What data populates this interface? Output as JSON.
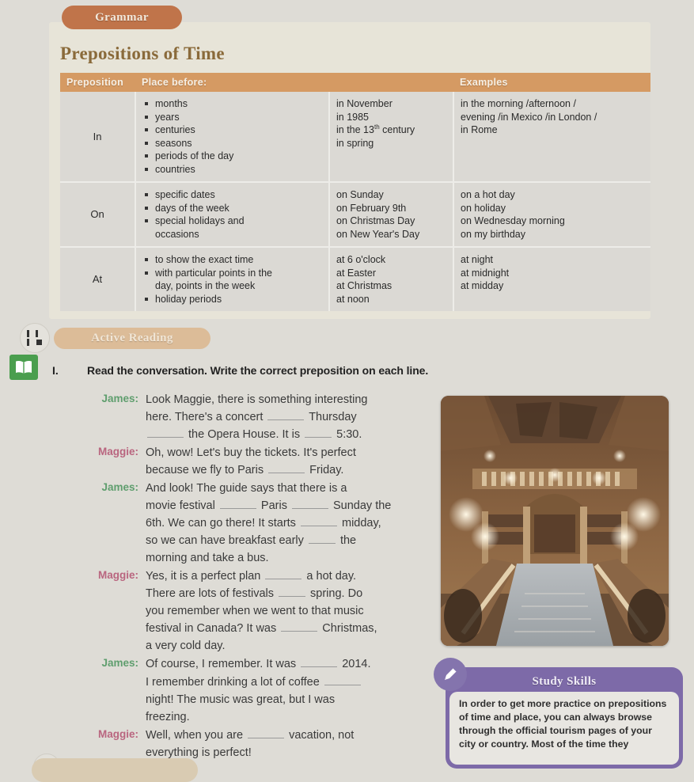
{
  "grammar": {
    "badge_label": "Grammar",
    "title": "Prepositions of Time",
    "table": {
      "headers": [
        "Preposition",
        "Place before:",
        "",
        "Examples"
      ],
      "rows": [
        {
          "preposition": "In",
          "rules": [
            "months",
            "years",
            "centuries",
            "seasons",
            "periods of the day",
            "countries"
          ],
          "examples_1": [
            "in November",
            "in 1985",
            "in the 13th century",
            "in spring"
          ],
          "examples_1_sup_index": 2,
          "examples_2": [
            "in the morning /afternoon /",
            "evening /in Mexico /in London /",
            "in Rome"
          ]
        },
        {
          "preposition": "On",
          "rules": [
            "specific dates",
            "days of the week",
            "special holidays and",
            "occasions"
          ],
          "continuation_index": 3,
          "examples_1": [
            "on Sunday",
            "on February 9th",
            "on Christmas Day",
            "on New Year's Day"
          ],
          "examples_2": [
            "on a hot day",
            "on holiday",
            "on Wednesday morning",
            "on my birthday"
          ]
        },
        {
          "preposition": "At",
          "rules": [
            "to show the exact time",
            "with particular points in the",
            "day, points in the week",
            "holiday periods"
          ],
          "continuation_index": 2,
          "examples_1": [
            "at 6 o'clock",
            "at Easter",
            "at Christmas",
            "at noon"
          ],
          "examples_2": [
            "at night",
            "at midnight",
            "at midday"
          ]
        }
      ]
    }
  },
  "active_reading": {
    "badge_label": "Active Reading",
    "qr_icon": "qr-code-icon",
    "book_icon": "open-book-icon"
  },
  "task": {
    "number": "I.",
    "instruction": "Read the conversation. Write the correct preposition on each line."
  },
  "conversation": [
    {
      "speaker": "James:",
      "speaker_color": "#5f9e6e",
      "lines": [
        [
          {
            "t": "Look Maggie, there is something interesting"
          }
        ],
        [
          {
            "t": "here. There's a concert "
          },
          {
            "blank": true
          },
          {
            "t": " Thursday"
          }
        ],
        [
          {
            "blank": true
          },
          {
            "t": " the Opera House. It is "
          },
          {
            "blank": true,
            "short": true
          },
          {
            "t": " 5:30."
          }
        ]
      ]
    },
    {
      "speaker": "Maggie:",
      "speaker_color": "#b9657f",
      "lines": [
        [
          {
            "t": "Oh, wow! Let's buy the tickets. It's perfect"
          }
        ],
        [
          {
            "t": "because we fly to Paris "
          },
          {
            "blank": true
          },
          {
            "t": " Friday."
          }
        ]
      ]
    },
    {
      "speaker": "James:",
      "speaker_color": "#5f9e6e",
      "lines": [
        [
          {
            "t": "And look! The guide says that there is a"
          }
        ],
        [
          {
            "t": "movie festival "
          },
          {
            "blank": true
          },
          {
            "t": " Paris "
          },
          {
            "blank": true
          },
          {
            "t": " Sunday the"
          }
        ],
        [
          {
            "t": "6th. We can go there! It starts "
          },
          {
            "blank": true
          },
          {
            "t": " midday,"
          }
        ],
        [
          {
            "t": "so we can have breakfast early "
          },
          {
            "blank": true,
            "short": true
          },
          {
            "t": " the"
          }
        ],
        [
          {
            "t": "morning and take a bus."
          }
        ]
      ]
    },
    {
      "speaker": "Maggie:",
      "speaker_color": "#b9657f",
      "lines": [
        [
          {
            "t": "Yes, it is a perfect plan "
          },
          {
            "blank": true
          },
          {
            "t": " a hot day."
          }
        ],
        [
          {
            "t": "There are lots of festivals "
          },
          {
            "blank": true,
            "short": true
          },
          {
            "t": " spring. Do"
          }
        ],
        [
          {
            "t": "you remember when we went to that music"
          }
        ],
        [
          {
            "t": "festival in Canada? It was "
          },
          {
            "blank": true
          },
          {
            "t": " Christmas,"
          }
        ],
        [
          {
            "t": "a very cold day."
          }
        ]
      ]
    },
    {
      "speaker": "James:",
      "speaker_color": "#5f9e6e",
      "lines": [
        [
          {
            "t": "Of course, I remember. It was "
          },
          {
            "blank": true
          },
          {
            "t": " 2014."
          }
        ],
        [
          {
            "t": "I remember drinking a lot of coffee "
          },
          {
            "blank": true
          }
        ],
        [
          {
            "t": "night! The music was great, but I was"
          }
        ],
        [
          {
            "t": "freezing."
          }
        ]
      ]
    },
    {
      "speaker": "Maggie:",
      "speaker_color": "#b9657f",
      "lines": [
        [
          {
            "t": "Well, when you are "
          },
          {
            "blank": true
          },
          {
            "t": " vacation, not"
          }
        ],
        [
          {
            "t": "everything is perfect!"
          }
        ]
      ]
    }
  ],
  "photo": {
    "alt": "opera-house-grand-staircase-interior",
    "name": "opera-house-photo"
  },
  "study_skills": {
    "title": "Study Skills",
    "icon": "pencil-icon",
    "body": "In order to get more practice on prepositions of time and place, you can always browse through the official tourism pages of your city or country. Most of the time they"
  }
}
